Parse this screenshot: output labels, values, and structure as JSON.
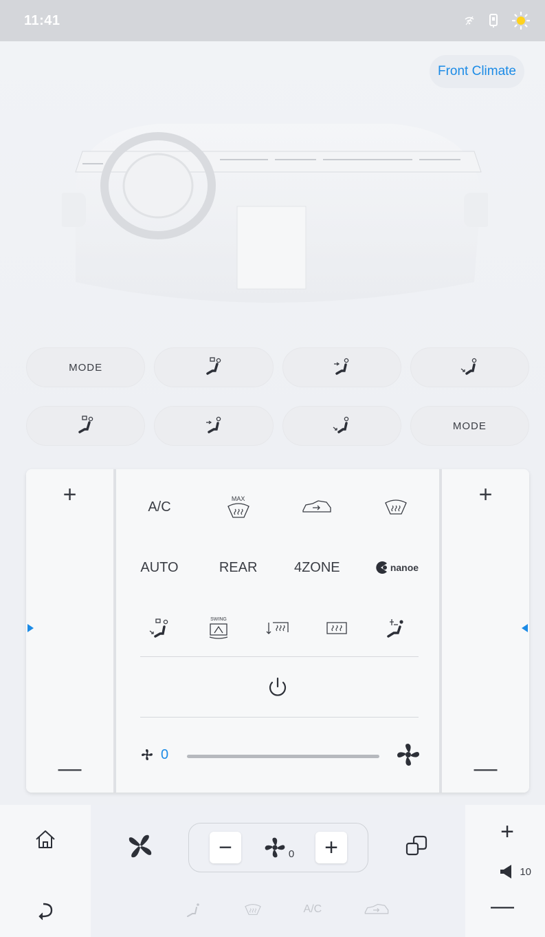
{
  "status_bar": {
    "time": "11:41",
    "icons": [
      "wifi-off-icon",
      "sim-icon",
      "brightness-icon"
    ]
  },
  "zone_title": "Front Climate",
  "mode_rows": {
    "row1": [
      {
        "label": "MODE"
      },
      {
        "icon": "defrost-face-vent-icon"
      },
      {
        "icon": "face-vent-icon"
      },
      {
        "icon": "foot-vent-icon"
      }
    ],
    "row2": [
      {
        "icon": "defrost-face-vent-icon"
      },
      {
        "icon": "face-vent-icon"
      },
      {
        "icon": "foot-vent-icon"
      },
      {
        "label": "MODE"
      }
    ]
  },
  "panel": {
    "left_temp": {
      "plus": "+",
      "minus": "—"
    },
    "right_temp": {
      "plus": "+",
      "minus": "—"
    },
    "row1": {
      "ac": "A/C",
      "max_label": "MAX"
    },
    "row2": {
      "auto": "AUTO",
      "rear": "REAR",
      "zone": "4ZONE",
      "nanoe": "nanoe"
    },
    "row3": {
      "swing_label": "SWING"
    },
    "fan_value": "0"
  },
  "dock": {
    "fan_minus": "−",
    "fan_plus": "+",
    "fan_level": "0",
    "volume_plus": "+",
    "volume_minus": "—",
    "volume_level": "10",
    "shortcut_ac": "A/C"
  },
  "colors": {
    "accent": "#1c8be6",
    "text": "#3a3d44",
    "disabled": "#c3c6cc"
  }
}
